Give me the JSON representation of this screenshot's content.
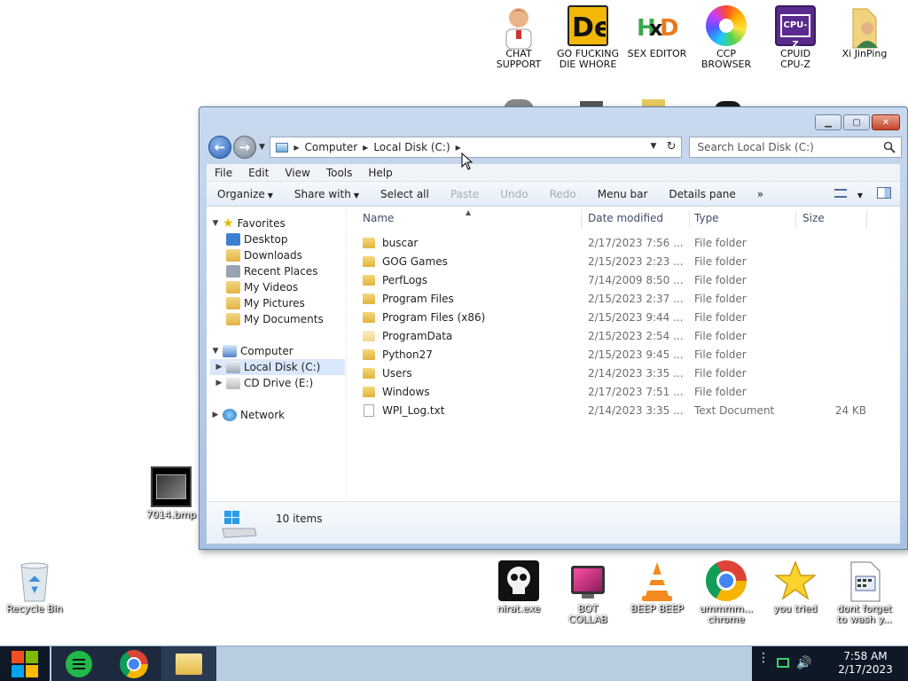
{
  "desktop": {
    "top_icons": [
      {
        "label": "CHAT\nSUPPORT",
        "icon": "doctor-icon"
      },
      {
        "label": "GO FUCKING\nDIE WHORE",
        "icon": "de-logo-icon"
      },
      {
        "label": "SEX EDITOR",
        "icon": "hxd-icon"
      },
      {
        "label": "CCP\nBROWSER",
        "icon": "ccp-browser-icon"
      },
      {
        "label": "CPUID\nCPU-Z",
        "icon": "cpuz-icon"
      },
      {
        "label": "Xi JinPing",
        "icon": "user-folder-icon"
      }
    ],
    "left_icons": [
      {
        "label": "7014.bmp",
        "icon": "bitmap-file-icon"
      },
      {
        "label": "Recycle Bin",
        "icon": "recycle-bin-icon"
      }
    ],
    "bottom_icons": [
      {
        "label": "nirat.exe",
        "icon": "skull-icon"
      },
      {
        "label": "BOT\nCOLLAB",
        "icon": "collab-app-icon"
      },
      {
        "label": "BEEP BEEP",
        "icon": "vlc-cone-icon"
      },
      {
        "label": "ummmm...\nchrome",
        "icon": "chrome-icon"
      },
      {
        "label": "you tried",
        "icon": "gold-star-icon"
      },
      {
        "label": "dont forget\nto wash y...",
        "icon": "text-document-icon"
      }
    ]
  },
  "window": {
    "breadcrumb": [
      "Computer",
      "Local Disk (C:)"
    ],
    "search_placeholder": "Search Local Disk (C:)",
    "menu": [
      "File",
      "Edit",
      "View",
      "Tools",
      "Help"
    ],
    "toolbar": {
      "organize": "Organize",
      "share_with": "Share with",
      "select_all": "Select all",
      "paste": "Paste",
      "undo": "Undo",
      "redo": "Redo",
      "menu_bar": "Menu bar",
      "details_pane": "Details pane",
      "more": "»"
    },
    "nav_pane": {
      "favorites": "Favorites",
      "favorites_items": [
        "Desktop",
        "Downloads",
        "Recent Places",
        "My Videos",
        "My Pictures",
        "My Documents"
      ],
      "computer": "Computer",
      "drives": [
        "Local Disk (C:)",
        "CD Drive (E:)"
      ],
      "network": "Network",
      "selected": "Local Disk (C:)"
    },
    "columns": {
      "name": "Name",
      "date": "Date modified",
      "type": "Type",
      "size": "Size"
    },
    "files": [
      {
        "name": "buscar",
        "date": "2/17/2023 7:56 ...",
        "type": "File folder",
        "size": "",
        "kind": "folder"
      },
      {
        "name": "GOG Games",
        "date": "2/15/2023 2:23 ...",
        "type": "File folder",
        "size": "",
        "kind": "folder"
      },
      {
        "name": "PerfLogs",
        "date": "7/14/2009 8:50 ...",
        "type": "File folder",
        "size": "",
        "kind": "folder"
      },
      {
        "name": "Program Files",
        "date": "2/15/2023 2:37 ...",
        "type": "File folder",
        "size": "",
        "kind": "folder"
      },
      {
        "name": "Program Files (x86)",
        "date": "2/15/2023 9:44 ...",
        "type": "File folder",
        "size": "",
        "kind": "folder"
      },
      {
        "name": "ProgramData",
        "date": "2/15/2023 2:54 ...",
        "type": "File folder",
        "size": "",
        "kind": "folder-hidden"
      },
      {
        "name": "Python27",
        "date": "2/15/2023 9:45 ...",
        "type": "File folder",
        "size": "",
        "kind": "folder"
      },
      {
        "name": "Users",
        "date": "2/14/2023 3:35 ...",
        "type": "File folder",
        "size": "",
        "kind": "folder"
      },
      {
        "name": "Windows",
        "date": "2/17/2023 7:51 ...",
        "type": "File folder",
        "size": "",
        "kind": "folder"
      },
      {
        "name": "WPI_Log.txt",
        "date": "2/14/2023 3:35 ...",
        "type": "Text Document",
        "size": "24 KB",
        "kind": "text"
      }
    ],
    "details": {
      "items_count": "10 items"
    }
  },
  "taskbar": {
    "pinned": [
      "start-button",
      "notes-app",
      "chrome",
      "file-explorer"
    ],
    "time": "7:58 AM",
    "date": "2/17/2023"
  }
}
